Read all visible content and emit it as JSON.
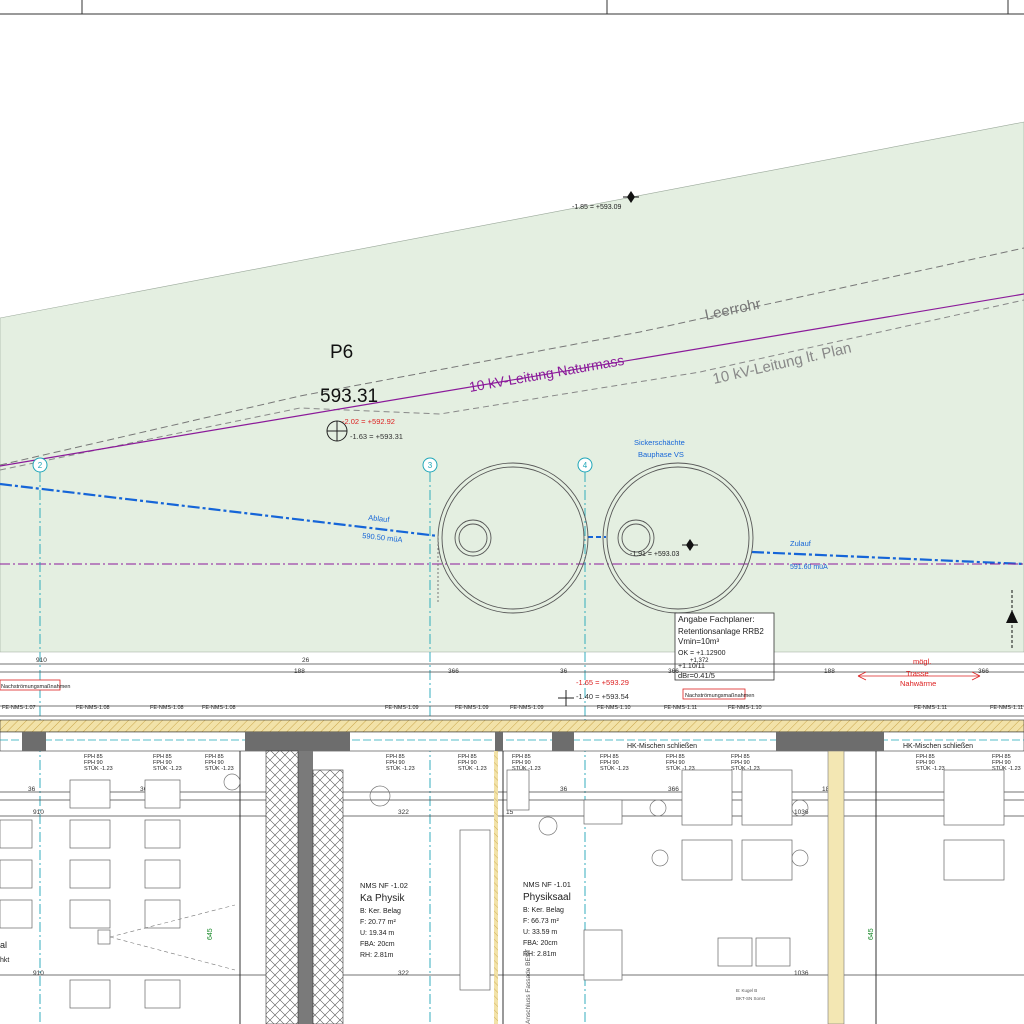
{
  "site": {
    "point_id": "P6",
    "point_elevation": "593.31",
    "top_marker": "-1.85 = +593.09",
    "red_level": "-2.02 = +592.92",
    "marker_level": "-1.63 = +593.31",
    "mid_marker": "-1.91 = +593.03",
    "red_level_2": "-1.65 = +593.29",
    "lower_level": "-1.40 = +593.54"
  },
  "lines": {
    "leerrohr": "Leerrohr",
    "kv_natur": "10 kV-Leitung Naturmass",
    "kv_plan": "10 kV-Leitung lt. Plan",
    "ablauf_label": "Ablauf",
    "ablauf_value": "590.50 müA",
    "zulauf_label": "Zulauf",
    "zulauf_value": "591.60 müA",
    "shafts_label_1": "Sickerschächte",
    "shafts_label_2": "Bauphase VS"
  },
  "axes": [
    "2",
    "3",
    "4"
  ],
  "note_box": {
    "line1": "Angabe Fachplaner:",
    "line2": "Retentionsanlage RRB2",
    "line3": "Vmin=10m³",
    "line4": "OK = +1.12900",
    "line5": "+1.372",
    "line6": "+1.10/11",
    "line7": "dBr=0.41/5"
  },
  "dims_top": [
    "910",
    "26",
    "188",
    "366",
    "36",
    "366",
    "188",
    "366"
  ],
  "dims_bottom": [
    "36",
    "366",
    "188",
    "26",
    "322",
    "15",
    "36",
    "366",
    "1036",
    "188",
    "366"
  ],
  "dims_lower": [
    "910",
    "26",
    "322",
    "1036"
  ],
  "nachstroemung_1": "Nachströmungsmaßnahmen",
  "nachstroemung_2": "Nachströmungsmaßnahmen",
  "trasse": {
    "l1": "mögl.",
    "l2": "Trasse",
    "l3": "Nahwärme"
  },
  "hk_label_1": "HK-Mischen schließen",
  "hk_label_2": "HK-Mischen schließen",
  "window_tags": [
    "FE-NMS-1.07",
    "FE-NMS-1.08",
    "FE-NMS-1.08",
    "FE-NMS-1.08",
    "FE-NMS-1.09",
    "FE-NMS-1.09",
    "FE-NMS-1.09",
    "FE-NMS-1.10",
    "FE-NMS-1.11",
    "FE-NMS-1.10",
    "FE-NMS-1.11",
    "FE-NMS-1.11"
  ],
  "fph": {
    "l1": "FPH 85",
    "l2": "FPH 90",
    "l3": "STÜK -1.23"
  },
  "room1": {
    "code": "NMS NF -1.02",
    "name": "Ka Physik",
    "floor": "B: Ker. Belag",
    "area": "F: 20.77 m²",
    "perimeter": "U: 19.34 m",
    "fba": "FBA: 20cm",
    "rh": "RH: 2.81m"
  },
  "room2": {
    "code": "NMS NF -1.01",
    "name": "Physiksaal",
    "floor": "B: Ker. Belag",
    "area": "F: 66.73 m²",
    "perimeter": "U: 33.59 m",
    "fba": "FBA: 20cm",
    "rh": "RH: 2.81m"
  },
  "wall_height": "645",
  "wall_height_2": "645",
  "side_text_1": "al",
  "side_text_2": "hkt",
  "vert_text": "Anschluss Fassade BEST",
  "small_text_1": "B: Kugel B",
  "small_text_2": "BKT-SN Sonst"
}
